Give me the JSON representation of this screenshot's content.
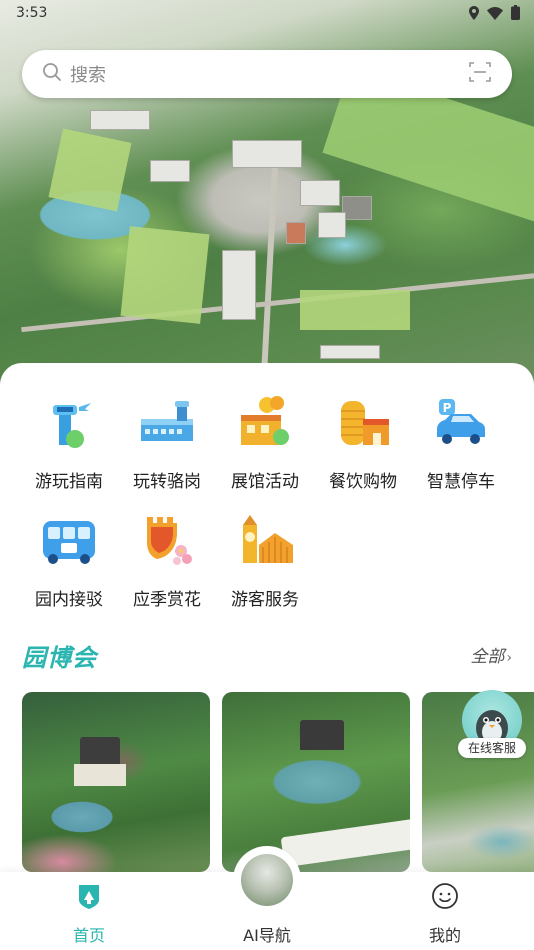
{
  "status_bar": {
    "time": "3:53"
  },
  "search": {
    "placeholder": "搜索"
  },
  "quick_links": [
    {
      "label": "游玩指南",
      "icon": "tower-guide-icon"
    },
    {
      "label": "玩转骆岗",
      "icon": "terminal-building-icon"
    },
    {
      "label": "展馆活动",
      "icon": "balloon-pavilion-icon"
    },
    {
      "label": "餐饮购物",
      "icon": "shopping-building-icon"
    },
    {
      "label": "智慧停车",
      "icon": "parking-car-icon"
    },
    {
      "label": "园内接驳",
      "icon": "shuttle-bus-icon"
    },
    {
      "label": "应季赏花",
      "icon": "flower-wall-icon"
    },
    {
      "label": "游客服务",
      "icon": "clock-tower-service-icon"
    }
  ],
  "section": {
    "title": "园博会",
    "more_label": "全部",
    "more_chevron": "›"
  },
  "floating_service": {
    "label": "在线客服"
  },
  "bottom_nav": [
    {
      "label": "首页",
      "active": true
    },
    {
      "label": "AI导航",
      "active": false
    },
    {
      "label": "我的",
      "active": false
    }
  ],
  "colors": {
    "accent": "#2ab5b0",
    "text": "#222222",
    "muted": "#8a8a8a"
  }
}
